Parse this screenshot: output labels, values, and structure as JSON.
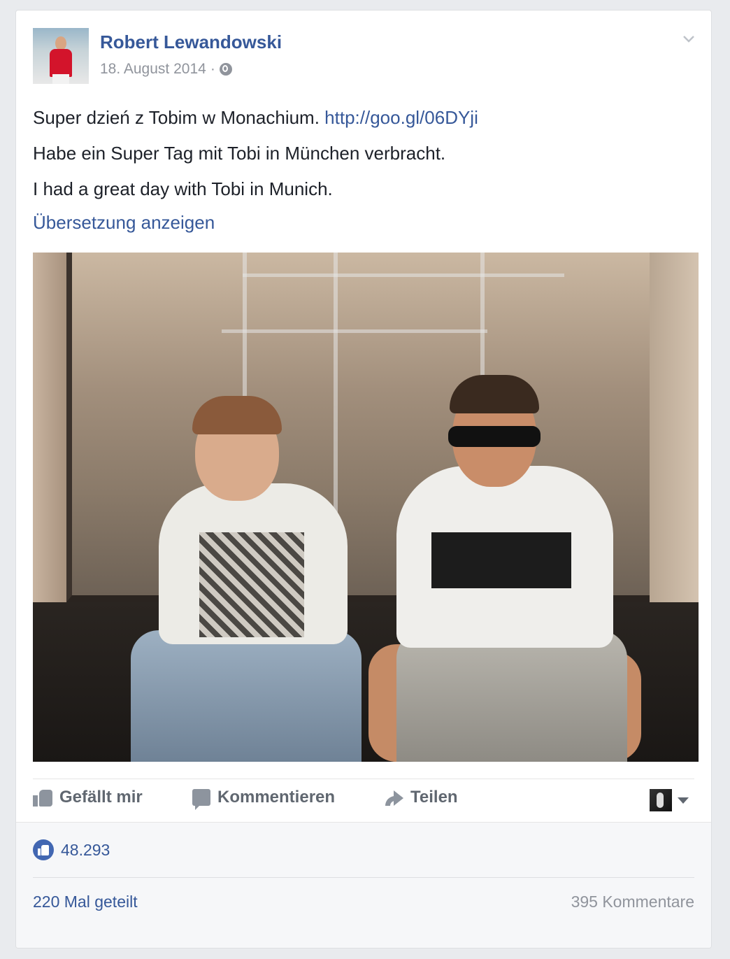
{
  "post": {
    "author": "Robert Lewandowski",
    "date": "18. August 2014",
    "separator": "·",
    "privacy_icon": "globe-icon",
    "lines": [
      "Super dzień z Tobim w Monachium.",
      "Habe ein Super Tag mit Tobi in München verbracht.",
      "I had a great day with Tobi in Munich."
    ],
    "link": "http://goo.gl/06DYji",
    "translate_label": "Übersetzung anzeigen",
    "photo_description": "two-men-sitting-in-front-of-shop-window"
  },
  "actions": {
    "like_label": "Gefällt mir",
    "comment_label": "Kommentieren",
    "share_label": "Teilen",
    "like_icon": "thumbs-up-icon",
    "comment_icon": "speech-bubble-icon",
    "share_icon": "share-arrow-icon"
  },
  "stats": {
    "like_count": "48.293",
    "shares": "220 Mal geteilt",
    "comments": "395 Kommentare"
  },
  "colors": {
    "link_blue": "#365899",
    "like_blue": "#4267b2",
    "meta_gray": "#90949c",
    "background": "#e9ebee"
  }
}
